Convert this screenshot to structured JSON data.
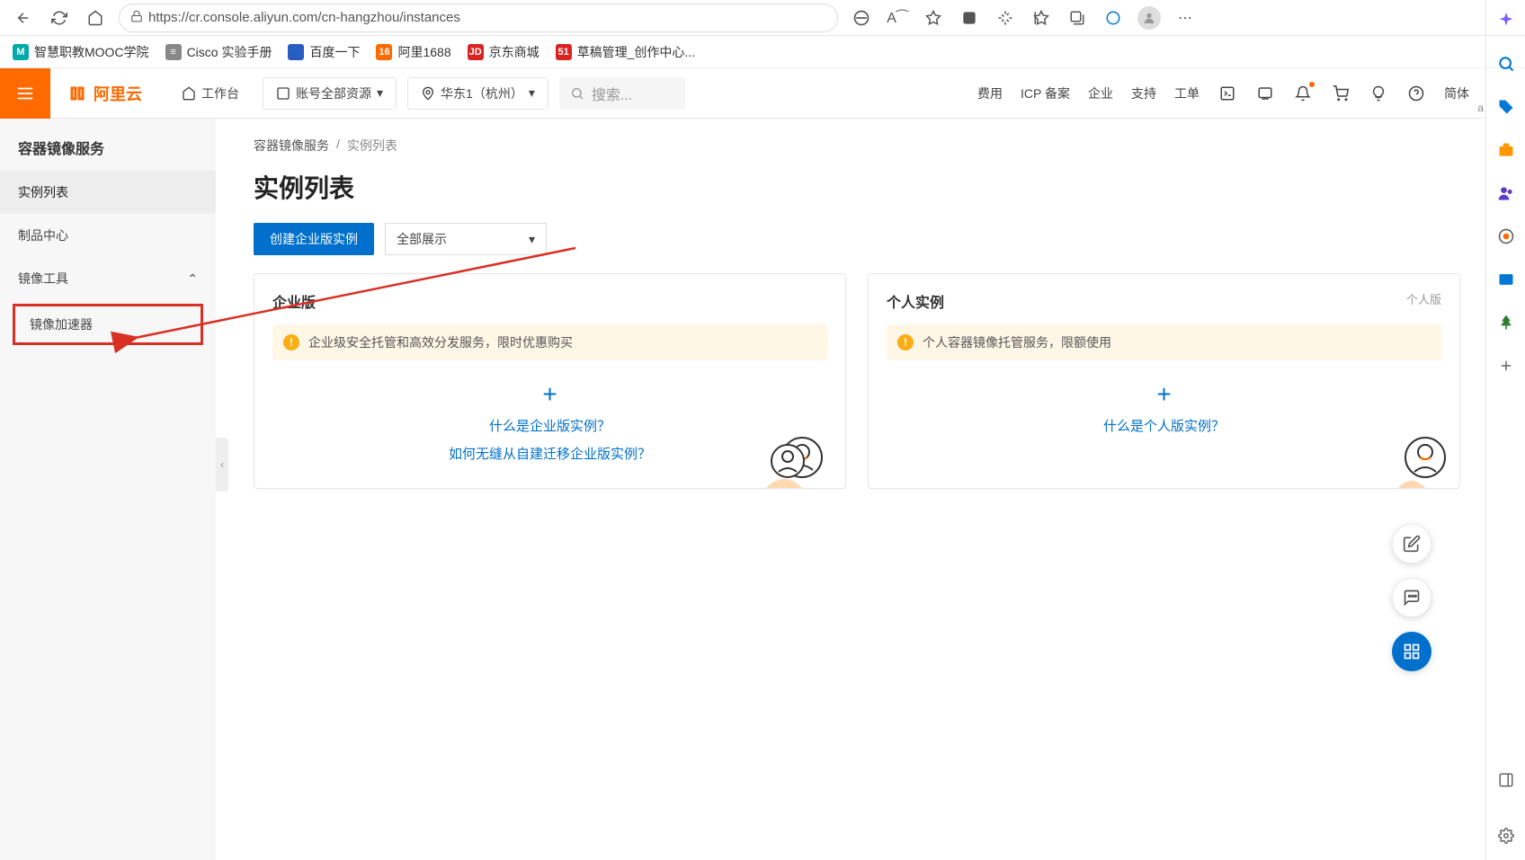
{
  "browser": {
    "url": "https://cr.console.aliyun.com/cn-hangzhou/instances",
    "bookmarks": [
      {
        "icon": "M",
        "color": "#0aa",
        "label": "智慧职教MOOC学院"
      },
      {
        "icon": "≡",
        "color": "#888",
        "label": "Cisco 实验手册"
      },
      {
        "icon": "🐾",
        "color": "#2b5cc4",
        "label": "百度一下"
      },
      {
        "icon": "16",
        "color": "#ff6a00",
        "label": "阿里1688"
      },
      {
        "icon": "JD",
        "color": "#d22",
        "label": "京东商城"
      },
      {
        "icon": "51",
        "color": "#d22",
        "label": "草稿管理_创作中心..."
      }
    ]
  },
  "header": {
    "logo_text": "阿里云",
    "workbench": "工作台",
    "account_resources": "账号全部资源",
    "region": "华东1（杭州）",
    "search_placeholder": "搜索...",
    "nav": [
      "费用",
      "ICP 备案",
      "企业",
      "支持",
      "工单"
    ],
    "lang": "简体"
  },
  "sidebar": {
    "title": "容器镜像服务",
    "items": [
      {
        "label": "实例列表",
        "active": true
      },
      {
        "label": "制品中心",
        "active": false
      },
      {
        "label": "镜像工具",
        "active": false,
        "expandable": true
      }
    ],
    "sub_item": "镜像加速器"
  },
  "breadcrumb": {
    "root": "容器镜像服务",
    "sep": "/",
    "current": "实例列表"
  },
  "page_title": "实例列表",
  "actions": {
    "create": "创建企业版实例",
    "filter": "全部展示"
  },
  "cards": {
    "enterprise": {
      "title": "企业版",
      "alert": "企业级安全托管和高效分发服务，限时优惠购买",
      "link1": "什么是企业版实例？",
      "link2": "如何无缝从自建迁移企业版实例？"
    },
    "personal": {
      "title": "个人实例",
      "tag": "个人版",
      "alert": "个人容器镜像托管服务，限额使用",
      "link1": "什么是个人版实例？"
    }
  },
  "tiny_a": "a"
}
